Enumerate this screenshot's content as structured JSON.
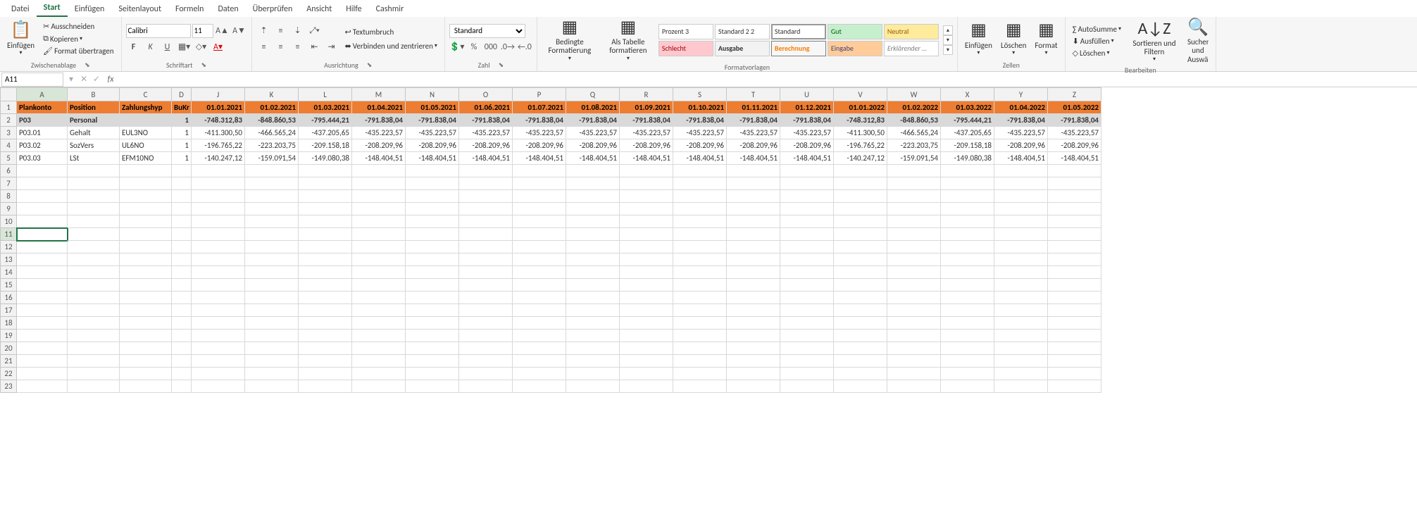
{
  "tabs": [
    "Datei",
    "Start",
    "Einfügen",
    "Seitenlayout",
    "Formeln",
    "Daten",
    "Überprüfen",
    "Ansicht",
    "Hilfe",
    "Cashmir"
  ],
  "active_tab": "Start",
  "clipboard": {
    "paste": "Einfügen",
    "cut": "Ausschneiden",
    "copy": "Kopieren",
    "format_painter": "Format übertragen",
    "group": "Zwischenablage"
  },
  "font": {
    "name": "Calibri",
    "size": "11",
    "group": "Schriftart"
  },
  "alignment": {
    "wrap": "Textumbruch",
    "merge": "Verbinden und zentrieren",
    "group": "Ausrichtung"
  },
  "number": {
    "format": "Standard",
    "group": "Zahl"
  },
  "cond": {
    "conditional": "Bedingte Formatierung",
    "as_table": "Als Tabelle formatieren"
  },
  "styles": {
    "prozent": "Prozent 3",
    "std22": "Standard 2 2",
    "std": "Standard",
    "gut": "Gut",
    "neutral": "Neutral",
    "schlecht": "Schlecht",
    "ausgabe": "Ausgabe",
    "berechnung": "Berechnung",
    "eingabe": "Eingabe",
    "erkl": "Erklärender …",
    "group": "Formatvorlagen"
  },
  "cells": {
    "insert": "Einfügen",
    "delete": "Löschen",
    "format": "Format",
    "group": "Zellen"
  },
  "editing": {
    "autosum": "AutoSumme",
    "fill": "Ausfüllen",
    "clear": "Löschen",
    "sort": "Sortieren und Filtern",
    "find": "Suchen und Auswählen",
    "group": "Bearbeiten"
  },
  "name_box": "A11",
  "col_letters": [
    "A",
    "B",
    "C",
    "D",
    "J",
    "K",
    "L",
    "M",
    "N",
    "O",
    "P",
    "Q",
    "R",
    "S",
    "T",
    "U",
    "V",
    "W",
    "X",
    "Y",
    "Z"
  ],
  "headers": {
    "A": "Plankonto",
    "B": "Position",
    "C": "Zahlungshyp",
    "D": "BuKr",
    "dates": [
      "01.01.2021",
      "01.02.2021",
      "01.03.2021",
      "01.04.2021",
      "01.05.2021",
      "01.06.2021",
      "01.07.2021",
      "01.08.2021",
      "01.09.2021",
      "01.10.2021",
      "01.11.2021",
      "01.12.2021",
      "01.01.2022",
      "01.02.2022",
      "01.03.2022",
      "01.04.2022",
      "01.05.2022"
    ]
  },
  "rows": [
    {
      "A": "P03",
      "B": "Personal",
      "C": "",
      "D": "1",
      "vals": [
        "-748.312,83",
        "-848.860,53",
        "-795.444,21",
        "-791.838,04",
        "-791.838,04",
        "-791.838,04",
        "-791.838,04",
        "-791.838,04",
        "-791.838,04",
        "-791.838,04",
        "-791.838,04",
        "-791.838,04",
        "-748.312,83",
        "-848.860,53",
        "-795.444,21",
        "-791.838,04",
        "-791.838,04"
      ],
      "cls": "gray"
    },
    {
      "A": "P03.01",
      "B": "Gehalt",
      "C": "EUL3NO",
      "D": "1",
      "vals": [
        "-411.300,50",
        "-466.565,24",
        "-437.205,65",
        "-435.223,57",
        "-435.223,57",
        "-435.223,57",
        "-435.223,57",
        "-435.223,57",
        "-435.223,57",
        "-435.223,57",
        "-435.223,57",
        "-435.223,57",
        "-411.300,50",
        "-466.565,24",
        "-437.205,65",
        "-435.223,57",
        "-435.223,57"
      ]
    },
    {
      "A": "P03.02",
      "B": "SozVers",
      "C": "UL6NO",
      "D": "1",
      "vals": [
        "-196.765,22",
        "-223.203,75",
        "-209.158,18",
        "-208.209,96",
        "-208.209,96",
        "-208.209,96",
        "-208.209,96",
        "-208.209,96",
        "-208.209,96",
        "-208.209,96",
        "-208.209,96",
        "-208.209,96",
        "-196.765,22",
        "-223.203,75",
        "-209.158,18",
        "-208.209,96",
        "-208.209,96"
      ]
    },
    {
      "A": "P03.03",
      "B": "LSt",
      "C": "EFM10NO",
      "D": "1",
      "vals": [
        "-140.247,12",
        "-159.091,54",
        "-149.080,38",
        "-148.404,51",
        "-148.404,51",
        "-148.404,51",
        "-148.404,51",
        "-148.404,51",
        "-148.404,51",
        "-148.404,51",
        "-148.404,51",
        "-148.404,51",
        "-140.247,12",
        "-159.091,54",
        "-149.080,38",
        "-148.404,51",
        "-148.404,51"
      ]
    }
  ],
  "empty_rows": 18,
  "selected": {
    "row": 11,
    "col": "A"
  }
}
